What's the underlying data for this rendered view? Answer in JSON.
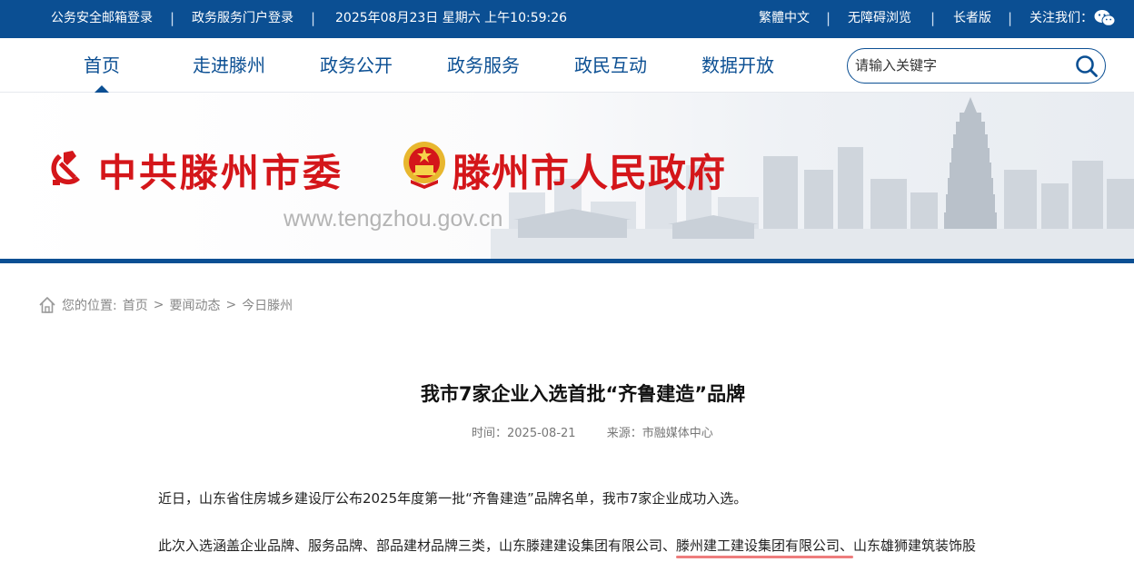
{
  "topbar": {
    "email_login": "公务安全邮箱登录",
    "portal_login": "政务服务门户登录",
    "datetime": "2025年08月23日 星期六 上午10:59:26",
    "traditional": "繁體中文",
    "accessible": "无障碍浏览",
    "elder": "长者版",
    "follow": "关注我们：",
    "separator": "|"
  },
  "nav": {
    "items": [
      {
        "label": "首页",
        "active": true
      },
      {
        "label": "走进滕州"
      },
      {
        "label": "政务公开"
      },
      {
        "label": "政务服务"
      },
      {
        "label": "政民互动"
      },
      {
        "label": "数据开放"
      }
    ],
    "search_placeholder": "请输入关键字"
  },
  "banner": {
    "party_title": "中共滕州市委",
    "gov_title": "滕州市人民政府",
    "url": "www.tengzhou.gov.cn"
  },
  "breadcrumb": {
    "prefix": "您的位置:",
    "items": [
      "首页",
      "要闻动态",
      "今日滕州"
    ],
    "sep": ">"
  },
  "article": {
    "title": "我市7家企业入选首批“齐鲁建造”品牌",
    "time": "时间：2025-08-21",
    "source": "来源：市融媒体中心",
    "para1": "近日，山东省住房城乡建设厅公布2025年度第一批“齐鲁建造”品牌名单，我市7家企业成功入选。",
    "para2_a": "此次入选涵盖企业品牌、服务品牌、部品建材品牌三类，山东滕建建设集团有限公司、",
    "para2_hl": "滕州建工建设集团有限公司、",
    "para2_b": "山东雄狮建筑装饰股"
  },
  "colors": {
    "brand_blue": "#0b4f93",
    "title_red": "#d4161a",
    "highlight_underline": "#ee7d7d"
  }
}
